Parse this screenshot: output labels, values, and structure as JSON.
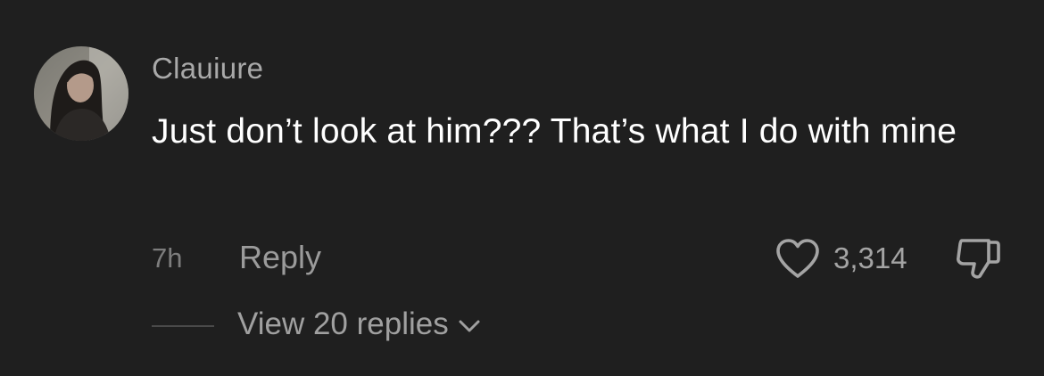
{
  "comment": {
    "username": "Clauiure",
    "text": "Just don’t look at him??? That’s what I do with mine",
    "time_ago": "7h",
    "reply_label": "Reply",
    "like_count": "3,314",
    "view_replies_label": "View 20 replies",
    "icons": {
      "like": "heart-icon",
      "dislike": "thumbs-down-icon",
      "expand": "chevron-down-icon"
    }
  },
  "colors": {
    "background": "#1f1f1f",
    "primary_text": "#ffffff",
    "secondary_text": "#a4a4a4",
    "muted_text": "#7d7d7d"
  }
}
